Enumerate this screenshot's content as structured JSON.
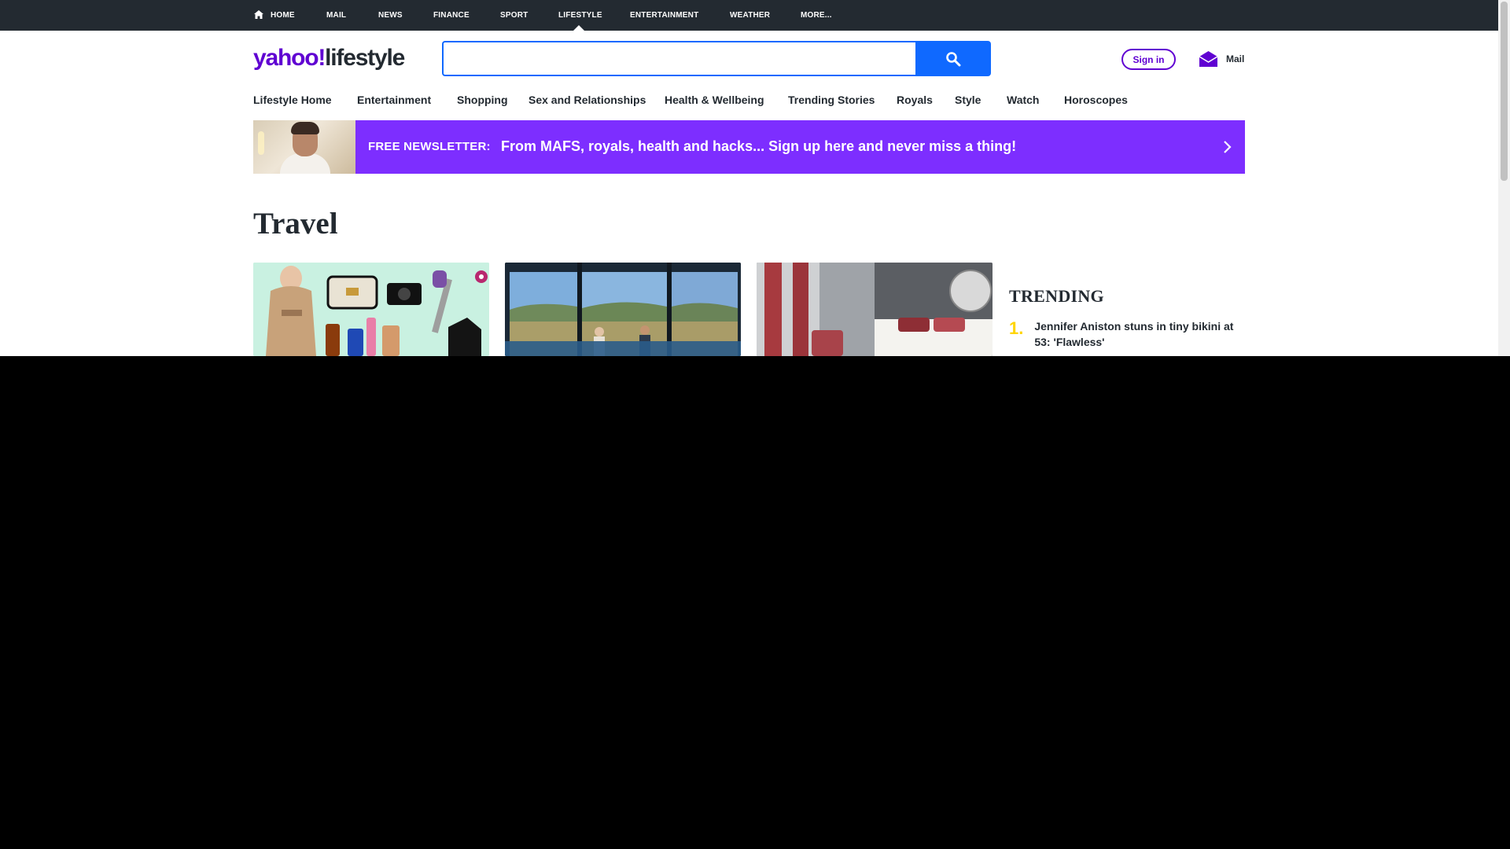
{
  "topbar": {
    "items": [
      "HOME",
      "MAIL",
      "NEWS",
      "FINANCE",
      "SPORT",
      "LIFESTYLE",
      "ENTERTAINMENT",
      "WEATHER",
      "MORE..."
    ],
    "active": "LIFESTYLE"
  },
  "header": {
    "logo_brand": "yahoo",
    "logo_slash": "!",
    "logo_section": "lifestyle",
    "search_value": "",
    "search_placeholder": "",
    "signin_label": "Sign in",
    "mail_label": "Mail"
  },
  "section_nav": {
    "items": [
      "Lifestyle Home",
      "Entertainment",
      "Shopping",
      "Sex and Relationships",
      "Health & Wellbeing",
      "Trending Stories",
      "Royals",
      "Style",
      "Watch",
      "Horoscopes"
    ]
  },
  "newsletter": {
    "tag": "FREE NEWSLETTER:",
    "message": "From MAFS, royals, health and hacks... Sign up here and never miss a thing!"
  },
  "page": {
    "title": "Travel"
  },
  "trending": {
    "title": "TRENDING",
    "items": [
      {
        "rank": "1.",
        "text": "Jennifer Aniston stuns in tiny bikini at 53: 'Flawless'"
      }
    ]
  },
  "colors": {
    "topbar_bg": "#232a31",
    "brand_purple": "#6001d2",
    "search_blue": "#0f69ff",
    "newsletter_purple": "#7d2eff",
    "trending_number": "#ffd500"
  }
}
